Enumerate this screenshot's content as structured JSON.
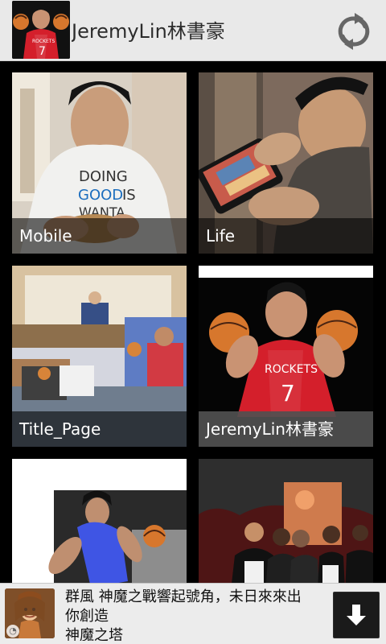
{
  "header": {
    "title": "JeremyLin林書豪",
    "avatar": "avatar",
    "refresh_icon": "refresh-icon"
  },
  "tiles": [
    {
      "label": "Mobile",
      "accent": "#d7d2c8"
    },
    {
      "label": "Life",
      "accent": "#6f5a4c"
    },
    {
      "label": "Title_Page",
      "accent": "#9f7e59"
    },
    {
      "label": "JeremyLin林書豪",
      "accent": "#d72731",
      "selected": true
    },
    {
      "label": "",
      "accent": "#2f54d1"
    },
    {
      "label": "",
      "accent": "#7f1d1d"
    }
  ],
  "ad": {
    "line1": "群風 神魔之戰響起號角，未日來來出",
    "line2": "你創造",
    "line3": "神魔之塔",
    "icon": "game-hero-icon",
    "download_icon": "download-icon"
  }
}
